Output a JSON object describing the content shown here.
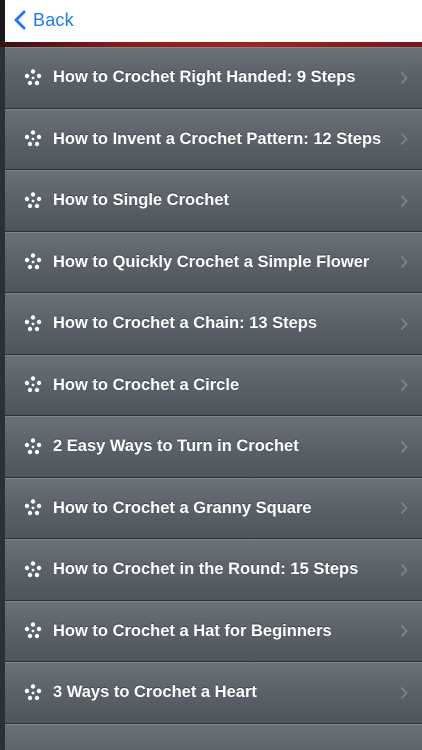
{
  "navbar": {
    "back_label": "Back"
  },
  "list": {
    "items": [
      {
        "label": "How to Crochet Right Handed: 9 Steps"
      },
      {
        "label": "How to Invent a Crochet Pattern: 12 Steps"
      },
      {
        "label": "How to Single Crochet"
      },
      {
        "label": "How to Quickly Crochet a Simple Flower"
      },
      {
        "label": "How to Crochet a Chain: 13 Steps"
      },
      {
        "label": "How to Crochet a Circle"
      },
      {
        "label": "2 Easy Ways to Turn in Crochet"
      },
      {
        "label": "How to Crochet a Granny Square"
      },
      {
        "label": "How to Crochet in the Round: 15 Steps"
      },
      {
        "label": "How to Crochet a Hat for Beginners"
      },
      {
        "label": "3 Ways to Crochet a Heart"
      },
      {
        "label": ""
      }
    ]
  },
  "colors": {
    "back_link": "#1a7cf0",
    "accent_bar": "#a42222",
    "row_background": "#5a6168",
    "row_text": "#ffffff"
  }
}
